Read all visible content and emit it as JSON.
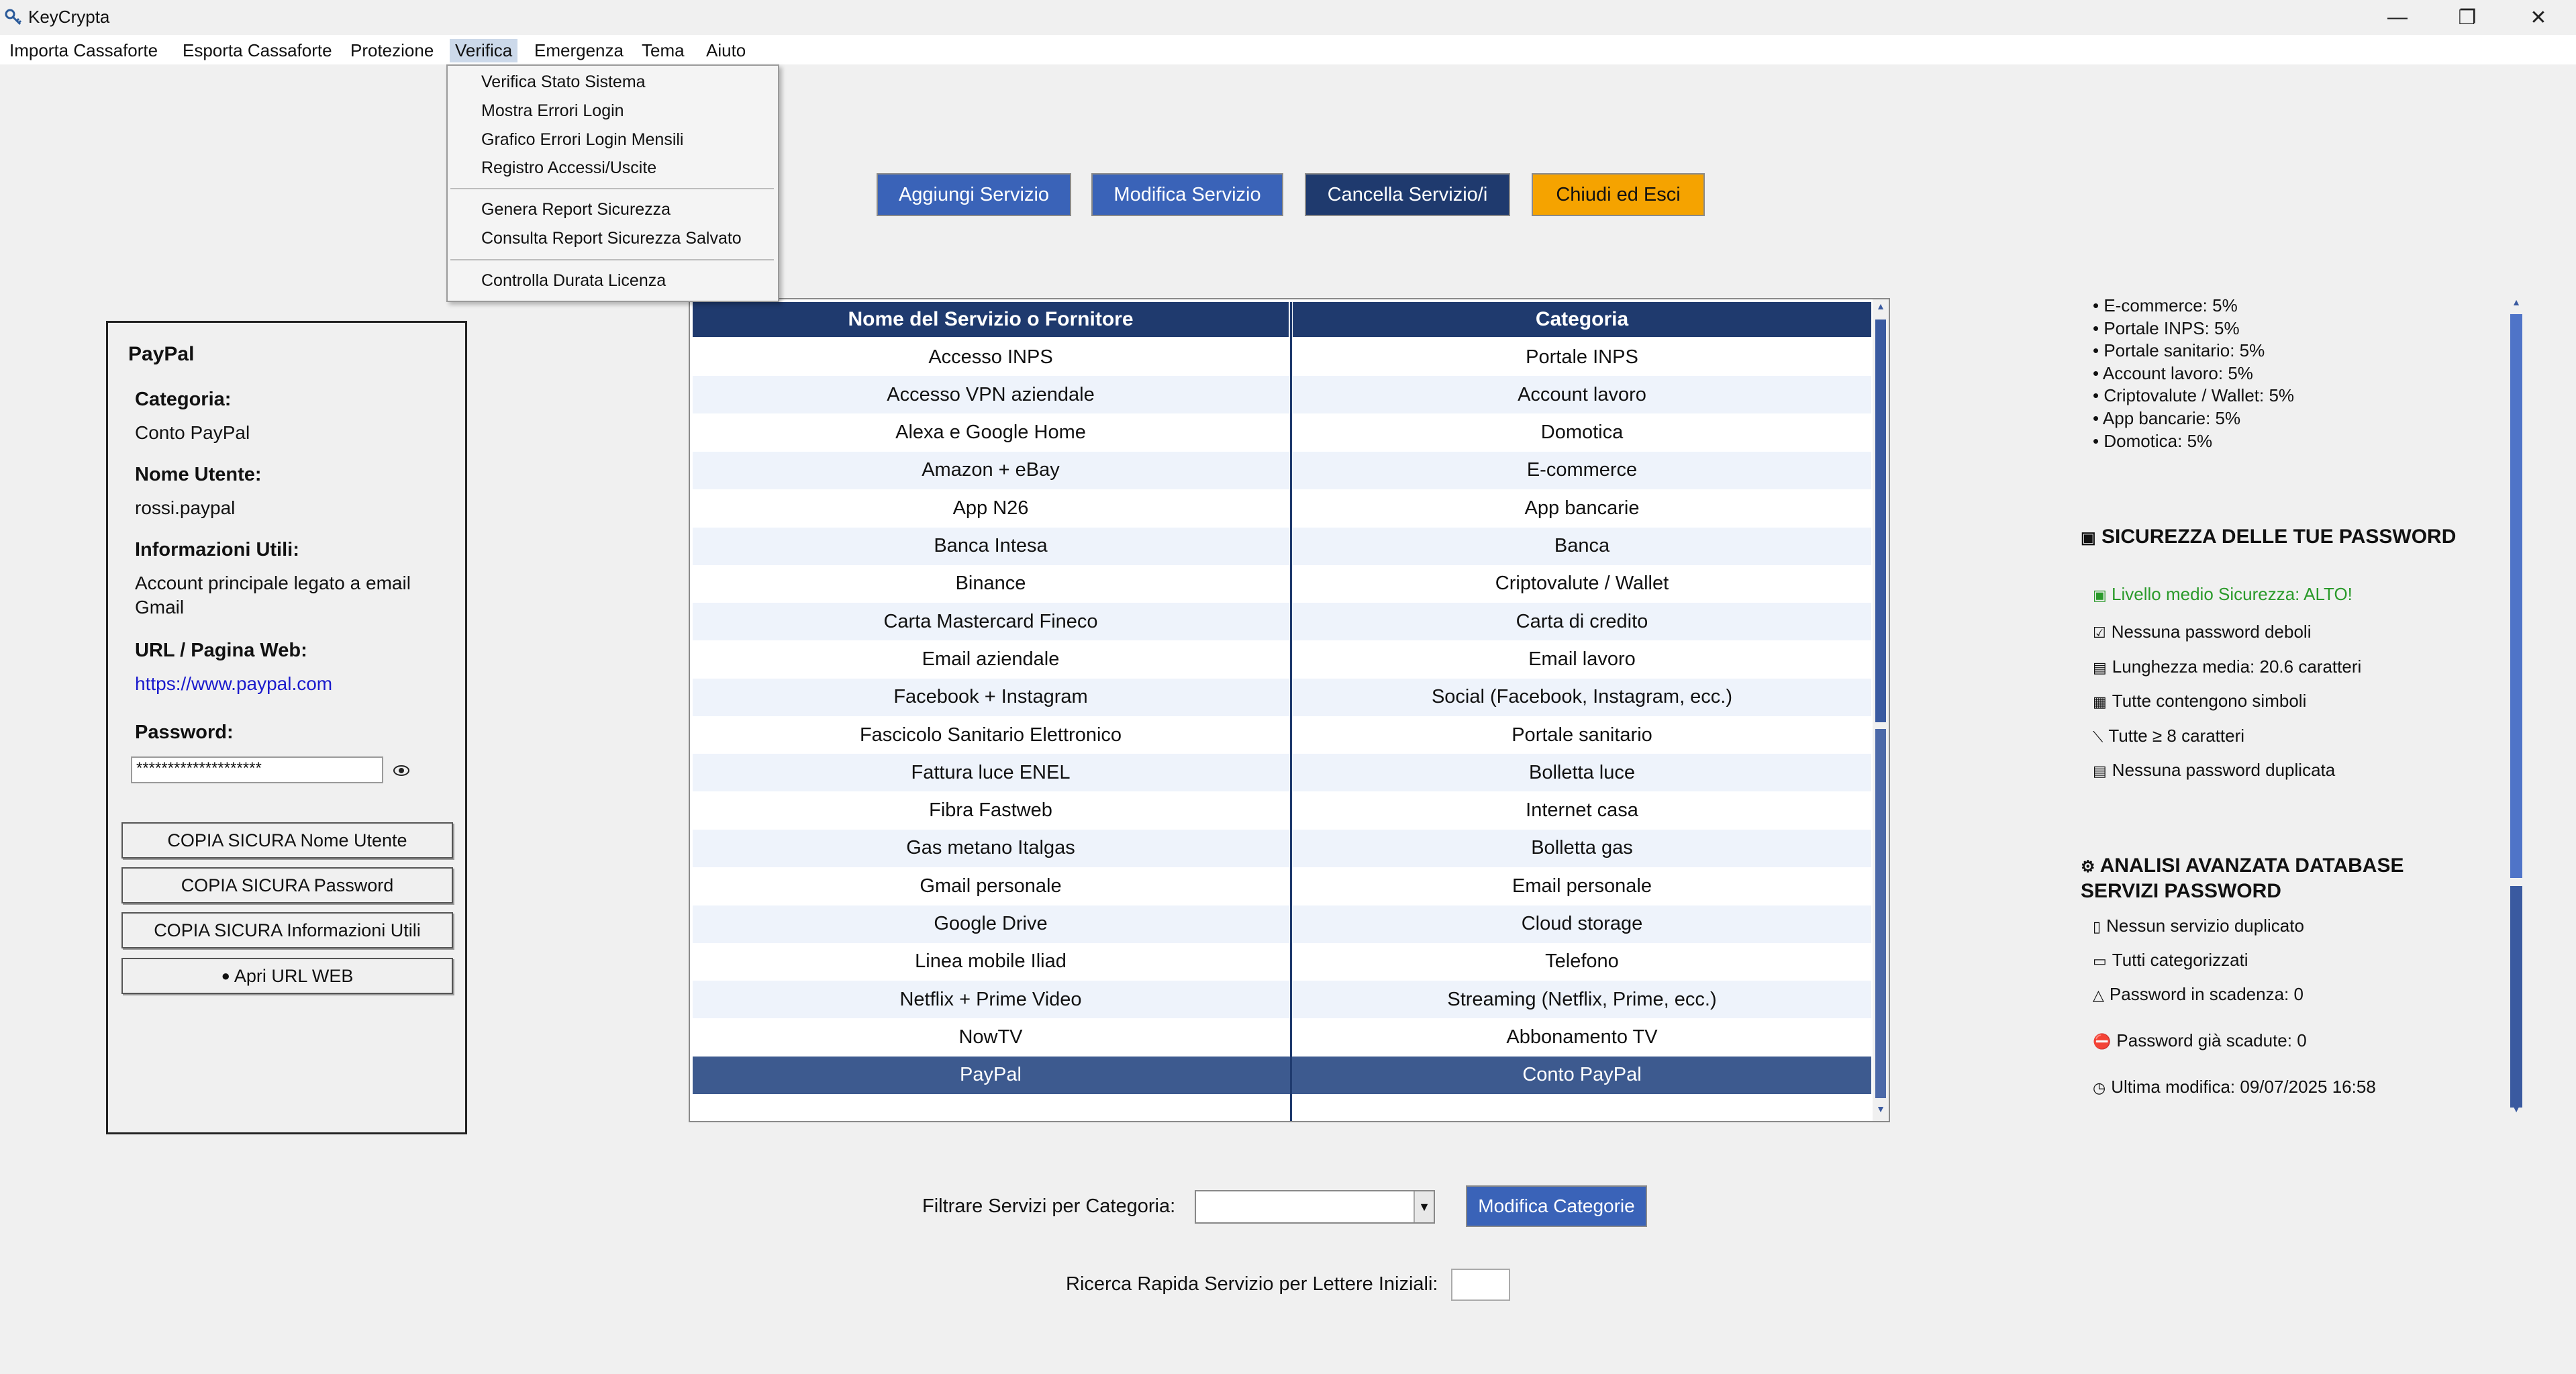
{
  "window": {
    "title": "KeyCrypta",
    "minimize": "—",
    "restore": "❐",
    "close": "✕"
  },
  "menu": [
    {
      "label": "Importa Cassaforte"
    },
    {
      "label": "Esporta Cassaforte"
    },
    {
      "label": "Protezione"
    },
    {
      "label": "Verifica"
    },
    {
      "label": "Emergenza"
    },
    {
      "label": "Tema"
    },
    {
      "label": "Aiuto"
    }
  ],
  "dropdown": {
    "items": [
      "Verifica Stato Sistema",
      "Mostra Errori Login",
      "Grafico Errori Login Mensili",
      "Registro Accessi/Uscite",
      "Genera Report Sicurezza",
      "Consulta Report Sicurezza Salvato",
      "Controlla Durata Licenza"
    ]
  },
  "toolbar": {
    "add": "Aggiungi Servizio",
    "edit": "Modifica Servizio",
    "delete": "Cancella Servizio/i",
    "exit": "Chiudi ed Esci",
    "colors": {
      "add": "#3a63b8",
      "edit": "#3a63b8",
      "delete": "#1f3a6e",
      "exit": "#f5a300"
    }
  },
  "details": {
    "title": "PayPal",
    "category_label": "Categoria:",
    "category_value": "Conto PayPal",
    "user_label": "Nome Utente:",
    "user_value": "rossi.paypal",
    "info_label": "Informazioni Utili:",
    "info_value": "Account principale legato a email Gmail",
    "url_label": "URL / Pagina Web:",
    "url_value": "https://www.paypal.com",
    "password_label": "Password:",
    "password_value": "********************",
    "copy_user": "COPIA SICURA Nome Utente",
    "copy_password": "COPIA SICURA Password",
    "copy_info": "COPIA SICURA Informazioni Utili",
    "open_url": "Apri URL WEB"
  },
  "table": {
    "headers": [
      "Nome del Servizio o Fornitore",
      "Categoria"
    ],
    "rows": [
      {
        "name": "Accesso INPS",
        "category": "Portale INPS"
      },
      {
        "name": "Accesso VPN aziendale",
        "category": "Account lavoro"
      },
      {
        "name": "Alexa e Google Home",
        "category": "Domotica"
      },
      {
        "name": "Amazon + eBay",
        "category": "E-commerce"
      },
      {
        "name": "App N26",
        "category": "App bancarie"
      },
      {
        "name": "Banca Intesa",
        "category": "Banca"
      },
      {
        "name": "Binance",
        "category": "Criptovalute / Wallet"
      },
      {
        "name": "Carta Mastercard Fineco",
        "category": "Carta di credito"
      },
      {
        "name": "Email aziendale",
        "category": "Email lavoro"
      },
      {
        "name": "Facebook + Instagram",
        "category": "Social (Facebook, Instagram, ecc.)"
      },
      {
        "name": "Fascicolo Sanitario Elettronico",
        "category": "Portale sanitario"
      },
      {
        "name": "Fattura luce ENEL",
        "category": "Bolletta luce"
      },
      {
        "name": "Fibra Fastweb",
        "category": "Internet casa"
      },
      {
        "name": "Gas metano Italgas",
        "category": "Bolletta gas"
      },
      {
        "name": "Gmail personale",
        "category": "Email personale"
      },
      {
        "name": "Google Drive",
        "category": "Cloud storage"
      },
      {
        "name": "Linea mobile Iliad",
        "category": "Telefono"
      },
      {
        "name": "Netflix + Prime Video",
        "category": "Streaming (Netflix, Prime, ecc.)"
      },
      {
        "name": "NowTV",
        "category": "Abbonamento TV"
      },
      {
        "name": "PayPal",
        "category": "Conto PayPal"
      }
    ],
    "selected": "PayPal"
  },
  "stats": {
    "category_shares": [
      "• E-commerce: 5%",
      "• Portale INPS: 5%",
      "• Portale sanitario: 5%",
      "• Account lavoro: 5%",
      "• Criptovalute / Wallet: 5%",
      "• App bancarie: 5%",
      "• Domotica: 5%"
    ],
    "security_title": "SICUREZZA DELLE TUE PASSWORD",
    "security_level": "Livello medio Sicurezza: ALTO!",
    "security_items": [
      {
        "icon": "check-icon",
        "glyph": "☑",
        "text": "Nessuna password deboli"
      },
      {
        "icon": "ruler-icon",
        "glyph": "▤",
        "text": "Lunghezza media: 20.6 caratteri"
      },
      {
        "icon": "symbol-icon",
        "glyph": "▦",
        "text": "Tutte contengono simboli"
      },
      {
        "icon": "length-icon",
        "glyph": "⟍",
        "text": "Tutte ≥ 8 caratteri"
      },
      {
        "icon": "duplicate-icon",
        "glyph": "▤",
        "text": "Nessuna password duplicata"
      }
    ],
    "analysis_title": "ANALISI AVANZATA DATABASE SERVIZI PASSWORD",
    "analysis_items": [
      {
        "icon": "doc-icon",
        "glyph": "▯",
        "text": "Nessun servizio duplicato"
      },
      {
        "icon": "folder-icon",
        "glyph": "▭",
        "text": "Tutti categorizzati"
      },
      {
        "icon": "bell-icon",
        "glyph": "△",
        "text": "Password in scadenza: 0"
      },
      {
        "icon": "no-entry-icon",
        "glyph": "⛔",
        "text": "Password già scadute: 0"
      },
      {
        "icon": "clock-icon",
        "glyph": "◷",
        "text": "Ultima modifica: 09/07/2025 16:58"
      }
    ]
  },
  "filter": {
    "label": "Filtrare Servizi per Categoria:",
    "value": "",
    "edit_button": "Modifica Categorie"
  },
  "search": {
    "label": "Ricerca Rapida Servizio per Lettere Iniziali:",
    "value": ""
  }
}
